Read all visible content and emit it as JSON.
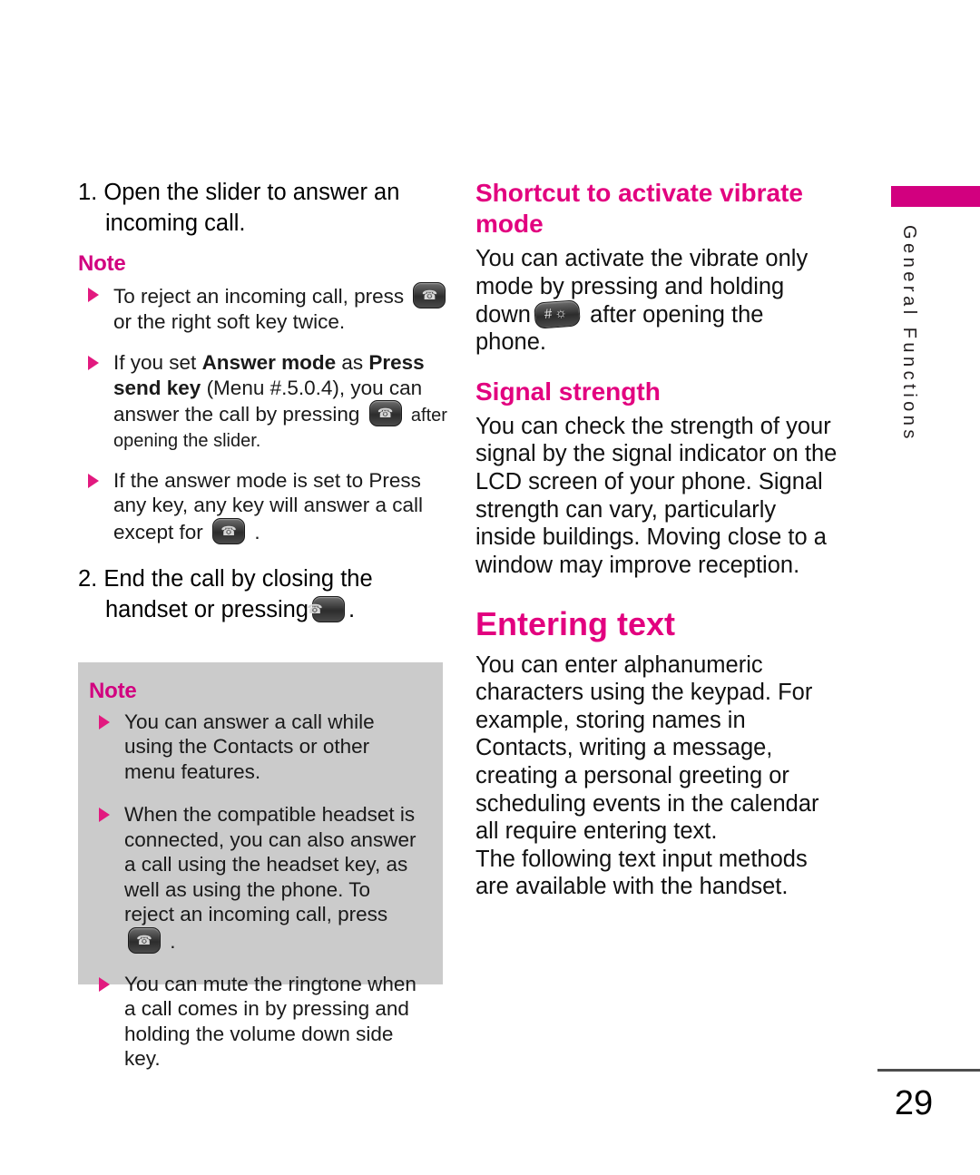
{
  "page": {
    "number": "29",
    "side_tab": "General Functions",
    "accent_color": "#E2007F",
    "tab_bar_color": "#D2007F",
    "note_box_color": "#CBCBCB"
  },
  "left_column": {
    "step1": {
      "number": "1.",
      "text": "Open the slider to answer an incoming call."
    },
    "note_label": "Note",
    "note_items": [
      {
        "part1": "To reject an incoming call, press",
        "icon": "end-call-key-icon",
        "part2": "or the right soft key twice."
      },
      {
        "part1": "If you set ",
        "bold1": "Answer mode",
        "mid1": " as ",
        "bold2": "Press send key",
        "mid2": " (Menu #.5.0.4), you can answer the call by pressing",
        "icon": "end-call-key-icon",
        "small_tail": "after opening the slider."
      },
      {
        "part1": "If the answer mode is set to Press any key, any key will answer a call except for",
        "icon": "end-call-key-icon",
        "part2": "."
      }
    ],
    "step2": {
      "number": "2.",
      "text_before": "End the call by closing the handset or pressing",
      "icon": "end-call-key-icon",
      "text_after": "."
    },
    "note_box": {
      "label": "Note",
      "items": [
        {
          "text": "You can answer a call while using the Contacts or other menu features."
        },
        {
          "part1": "When the compatible headset is connected, you can also answer a call using the headset key, as well as using the phone. To reject an incoming call, press",
          "icon": "end-call-key-icon",
          "part2": "."
        },
        {
          "text": "You can mute the ringtone when a call comes in by pressing and holding the volume down side key."
        }
      ]
    }
  },
  "right_column": {
    "heading_vibrate": "Shortcut to activate vibrate mode",
    "vibrate_text_before": "You can activate the vibrate only mode by pressing and holding down",
    "vibrate_icon": "hash-vibrate-key-icon",
    "vibrate_icon_glyph": "#",
    "vibrate_text_after": "after opening the phone.",
    "heading_signal": "Signal strength",
    "signal_text": "You can check the strength of your signal by the signal indicator on the LCD screen of your phone. Signal strength can vary, particularly inside buildings. Moving close to a window may improve reception.",
    "heading_entering": "Entering text",
    "entering_text_par1": "You can enter alphanumeric characters using the keypad. For example, storing names in Contacts, writing a message, creating a personal greeting or scheduling events in the calendar all require entering text.",
    "entering_text_par2": "The following text input methods are available with the handset."
  }
}
